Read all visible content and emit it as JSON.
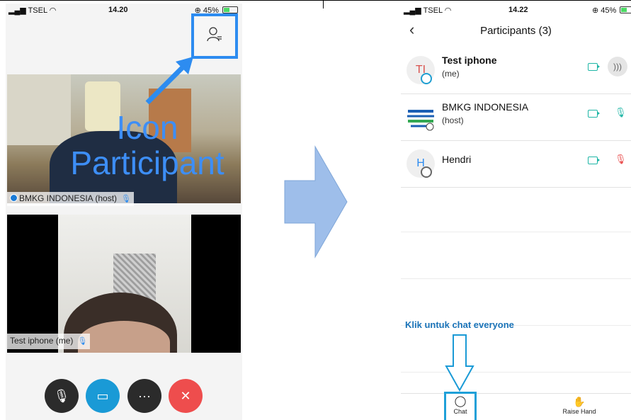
{
  "left": {
    "status": {
      "carrier": "TSEL",
      "time": "14.20",
      "battery": "45%"
    },
    "overlay": {
      "line1": "Icon",
      "line2": "Participant"
    },
    "video1_label": "BMKG INDONESIA (host)",
    "video2_label": "Test iphone (me)",
    "controls": {
      "mic": "",
      "camera": "",
      "more": "···",
      "end": "✕"
    }
  },
  "right": {
    "status": {
      "carrier": "TSEL",
      "time": "14.22",
      "battery": "45%"
    },
    "title": "Participants (3)",
    "back": "‹",
    "participants": [
      {
        "initials": "TI",
        "name": "Test iphone",
        "role": "(me)"
      },
      {
        "initials": "",
        "name": "BMKG INDONESIA",
        "role": "(host)"
      },
      {
        "initials": "H",
        "name": "Hendri",
        "role": ""
      }
    ],
    "hint": "Klik untuk chat everyone",
    "bottom": {
      "chat": "Chat",
      "raise_hand": "Raise Hand"
    }
  }
}
